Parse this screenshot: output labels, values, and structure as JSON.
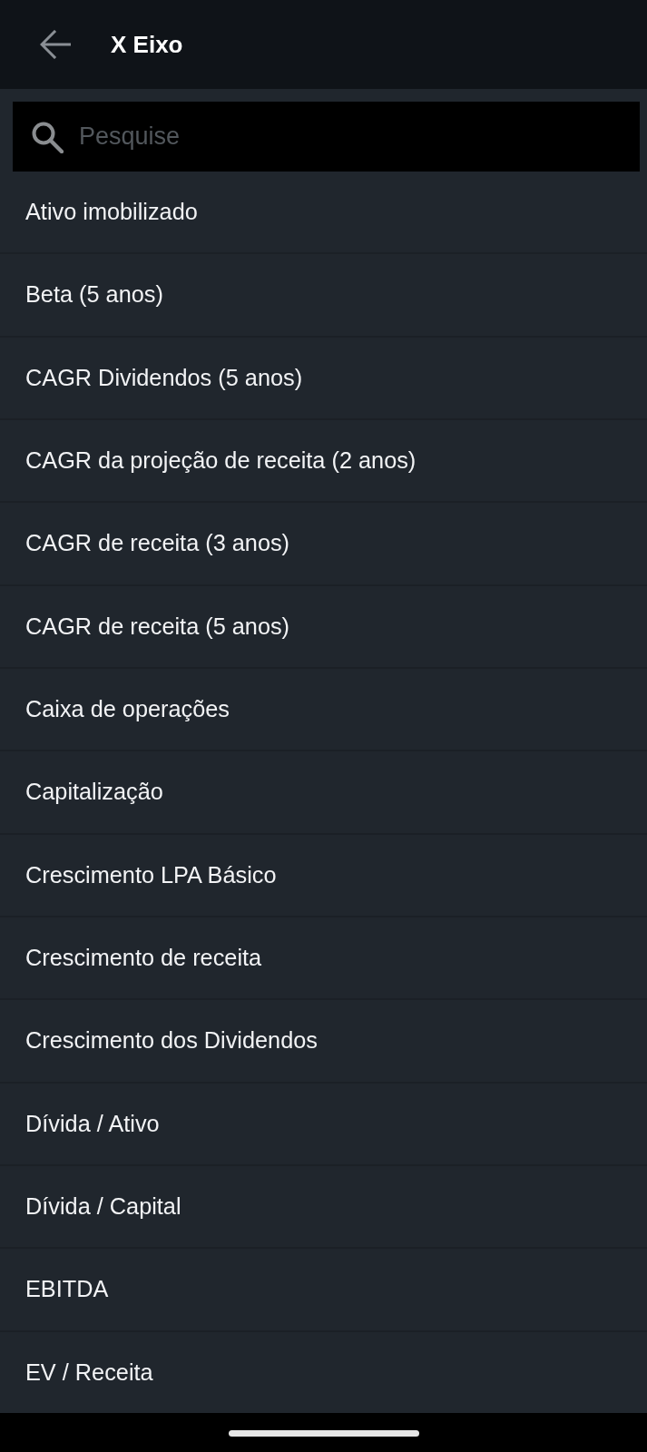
{
  "header": {
    "title": "X Eixo"
  },
  "search": {
    "placeholder": "Pesquise"
  },
  "items": [
    {
      "label": "Ativo imobilizado"
    },
    {
      "label": "Beta (5 anos)"
    },
    {
      "label": "CAGR Dividendos (5 anos)"
    },
    {
      "label": "CAGR da projeção de receita (2 anos)"
    },
    {
      "label": "CAGR de receita (3 anos)"
    },
    {
      "label": "CAGR de receita (5 anos)"
    },
    {
      "label": "Caixa de operações"
    },
    {
      "label": "Capitalização"
    },
    {
      "label": "Crescimento LPA Básico"
    },
    {
      "label": "Crescimento de receita"
    },
    {
      "label": "Crescimento dos Dividendos"
    },
    {
      "label": "Dívida / Ativo"
    },
    {
      "label": "Dívida / Capital"
    },
    {
      "label": "EBITDA"
    },
    {
      "label": "EV / Receita"
    }
  ]
}
